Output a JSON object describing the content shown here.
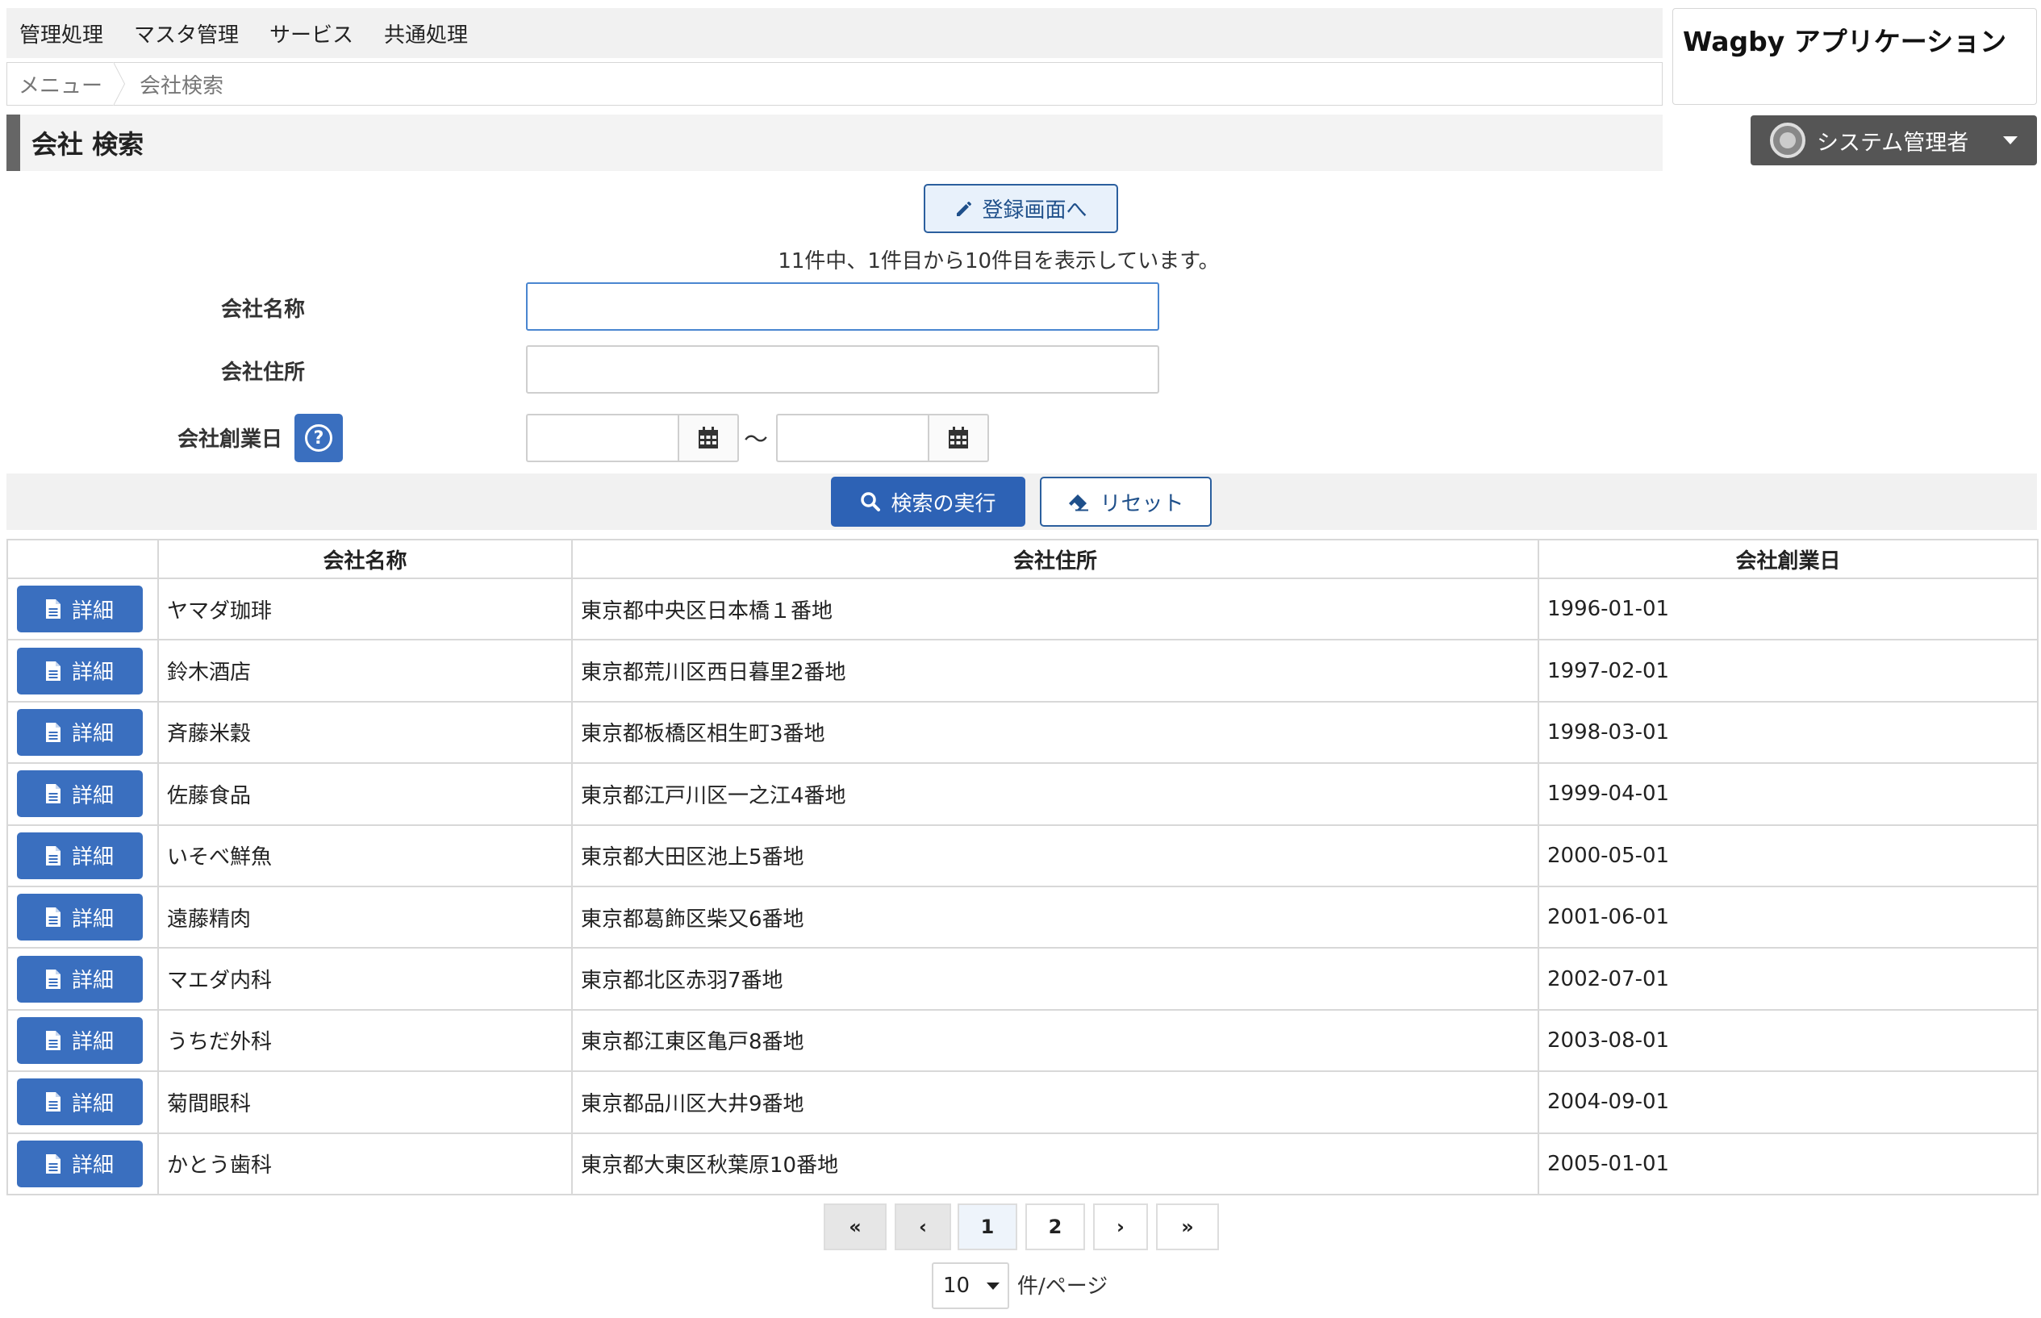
{
  "menu": {
    "items": [
      "管理処理",
      "マスタ管理",
      "サービス",
      "共通処理"
    ]
  },
  "breadcrumb": {
    "home": "メニュー",
    "current": "会社検索"
  },
  "app": {
    "title": "Wagby アプリケーション"
  },
  "page": {
    "title": "会社 検索"
  },
  "user": {
    "name": "システム管理者",
    "icon": "user-avatar-icon"
  },
  "toolbar": {
    "register_label": "登録画面へ",
    "register_icon": "pencil-icon"
  },
  "result_summary": "11件中、1件目から10件目を表示しています。",
  "form": {
    "name_label": "会社名称",
    "name_value": "",
    "address_label": "会社住所",
    "address_value": "",
    "founded_label": "会社創業日",
    "founded_from": "",
    "founded_to": "",
    "range_separator": "〜",
    "help_icon": "question-circle-icon",
    "calendar_icon": "calendar-icon"
  },
  "actions": {
    "search_label": "検索の実行",
    "search_icon": "search-icon",
    "reset_label": "リセット",
    "reset_icon": "eraser-icon"
  },
  "table": {
    "headers": [
      "",
      "会社名称",
      "会社住所",
      "会社創業日"
    ],
    "detail_label": "詳細",
    "detail_icon": "document-icon",
    "rows": [
      {
        "name": "ヤマダ珈琲",
        "address": "東京都中央区日本橋１番地",
        "founded": "1996-01-01"
      },
      {
        "name": "鈴木酒店",
        "address": "東京都荒川区西日暮里2番地",
        "founded": "1997-02-01"
      },
      {
        "name": "斉藤米穀",
        "address": "東京都板橋区相生町3番地",
        "founded": "1998-03-01"
      },
      {
        "name": "佐藤食品",
        "address": "東京都江戸川区一之江4番地",
        "founded": "1999-04-01"
      },
      {
        "name": "いそべ鮮魚",
        "address": "東京都大田区池上5番地",
        "founded": "2000-05-01"
      },
      {
        "name": "遠藤精肉",
        "address": "東京都葛飾区柴又6番地",
        "founded": "2001-06-01"
      },
      {
        "name": "マエダ内科",
        "address": "東京都北区赤羽7番地",
        "founded": "2002-07-01"
      },
      {
        "name": "うちだ外科",
        "address": "東京都江東区亀戸8番地",
        "founded": "2003-08-01"
      },
      {
        "name": "菊間眼科",
        "address": "東京都品川区大井9番地",
        "founded": "2004-09-01"
      },
      {
        "name": "かとう歯科",
        "address": "東京都大東区秋葉原10番地",
        "founded": "2005-01-01"
      }
    ]
  },
  "pagination": {
    "first": "«",
    "prev": "‹",
    "pages": [
      "1",
      "2"
    ],
    "current": "1",
    "next": "›",
    "last": "»"
  },
  "per_page": {
    "value": "10",
    "label": "件/ページ"
  }
}
